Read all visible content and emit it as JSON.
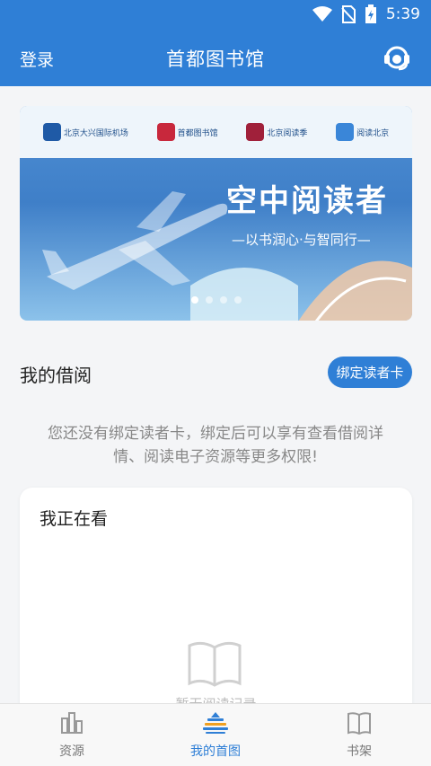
{
  "status_bar": {
    "time": "5:39"
  },
  "app_bar": {
    "login": "登录",
    "title": "首都图书馆"
  },
  "banner": {
    "logos": [
      {
        "text": "北京大兴国际机场"
      },
      {
        "text": "首都图书馆"
      },
      {
        "text": "北京阅读季"
      },
      {
        "text": "阅读北京"
      }
    ],
    "title": "空中阅读者",
    "slogan": "—以书润心·与智同行—",
    "slides": 4,
    "active_slide": 0
  },
  "borrow": {
    "title": "我的借阅",
    "bind_button": "绑定读者卡",
    "hint": "您还没有绑定读者卡，绑定后可以享有查看借阅详情、阅读电子资源等更多权限!"
  },
  "reading_card": {
    "title": "我正在看",
    "empty_text": "暂无阅读记录"
  },
  "bottom_nav": {
    "items": [
      {
        "label": "资源",
        "icon": "resources-icon"
      },
      {
        "label": "我的首图",
        "icon": "library-home-icon"
      },
      {
        "label": "书架",
        "icon": "bookshelf-icon"
      }
    ],
    "active_index": 1
  },
  "colors": {
    "primary": "#2f7fd6",
    "background": "#f4f5f7"
  }
}
